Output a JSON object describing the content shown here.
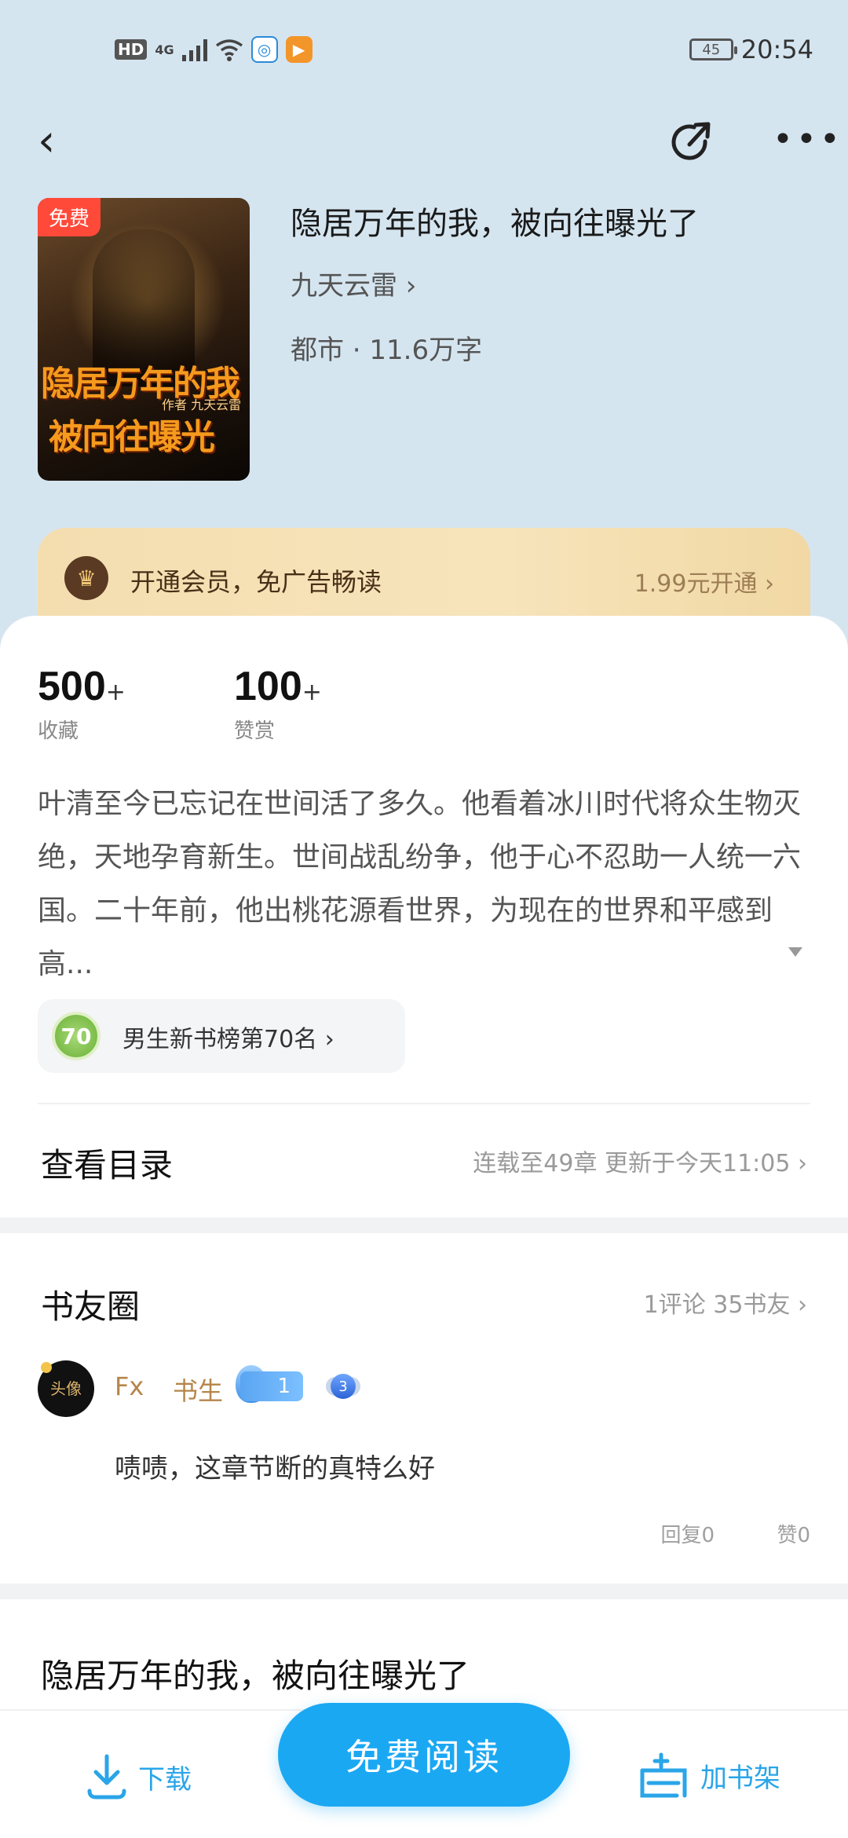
{
  "status_bar": {
    "hd": "HD",
    "network": "4G",
    "battery": "45",
    "time": "20:54"
  },
  "book": {
    "cover_badge": "免费",
    "cover_title_line1": "隐居万年的我",
    "cover_title_line2": "被向往曝光",
    "cover_author": "作者 九天云雷",
    "title": "隐居万年的我，被向往曝光了",
    "author": "九天云雷 ›",
    "meta": "都市 · 11.6万字"
  },
  "vip": {
    "icon": "crown-icon",
    "text": "开通会员，免广告畅读",
    "price": "1.99元开通 ›"
  },
  "stats": [
    {
      "value": "500",
      "suffix": "+",
      "label": "收藏"
    },
    {
      "value": "100",
      "suffix": "+",
      "label": "赞赏"
    }
  ],
  "description": "叶清至今已忘记在世间活了多久。他看着冰川时代将众生物灭绝，天地孕育新生。世间战乱纷争，他于心不忍助一人统一六国。二十年前，他出桃花源看世界，为现在的世界和平感到高...",
  "ranking": {
    "medal": "70",
    "text": "男生新书榜第70名 ›"
  },
  "toc": {
    "label": "查看目录",
    "status": "连载至49章   更新于今天11:05 ›"
  },
  "circle": {
    "title": "书友圈",
    "meta": "1评论 35书友 ›",
    "comment": {
      "avatar_text": "头像",
      "username": "Fx",
      "user_title": "书生",
      "fan_level": "1",
      "rank_level": "3",
      "content": "啧啧，这章节断的真特么好",
      "replies": "回复0",
      "likes": "赞0"
    }
  },
  "next_section_title": "隐居万年的我，被向往曝光了",
  "bottom": {
    "download": "下载",
    "read": "免费阅读",
    "shelf": "加书架"
  }
}
